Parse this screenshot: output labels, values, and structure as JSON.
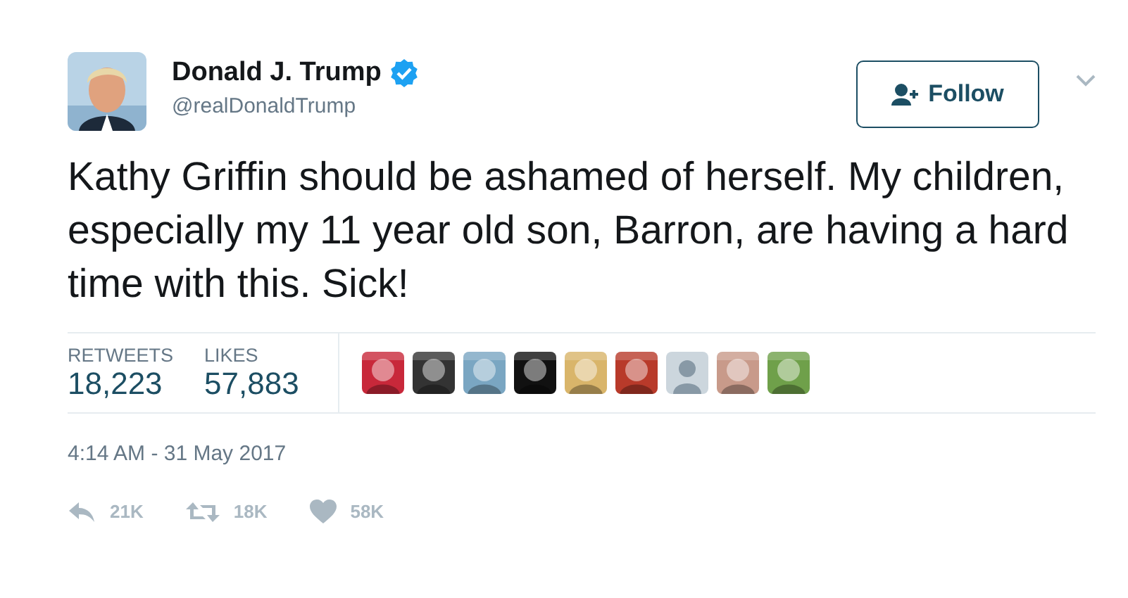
{
  "author": {
    "name": "Donald J. Trump",
    "verified": true,
    "handle": "@realDonaldTrump"
  },
  "follow_button": {
    "label": "Follow"
  },
  "tweet_text": "Kathy Griffin should be ashamed of herself. My children, especially my 11 year old son, Barron, are having a hard time with this. Sick!",
  "stats": [
    {
      "label": "RETWEETS",
      "value": "18,223"
    },
    {
      "label": "LIKES",
      "value": "57,883"
    }
  ],
  "likers": [
    {
      "kind": "picture",
      "color": "#c8283a"
    },
    {
      "kind": "picture",
      "color": "#333333"
    },
    {
      "kind": "picture",
      "color": "#7aa6c2"
    },
    {
      "kind": "picture",
      "color": "#111111"
    },
    {
      "kind": "picture",
      "color": "#d9b56a"
    },
    {
      "kind": "picture",
      "color": "#b83a2a"
    },
    {
      "kind": "default",
      "color": "#ccd6dd"
    },
    {
      "kind": "picture",
      "color": "#c89a8a"
    },
    {
      "kind": "picture",
      "color": "#6fa04a"
    }
  ],
  "timestamp": "4:14 AM - 31 May 2017",
  "actions": [
    {
      "kind": "reply",
      "count": "21K"
    },
    {
      "kind": "retweet",
      "count": "18K"
    },
    {
      "kind": "like",
      "count": "58K"
    }
  ]
}
